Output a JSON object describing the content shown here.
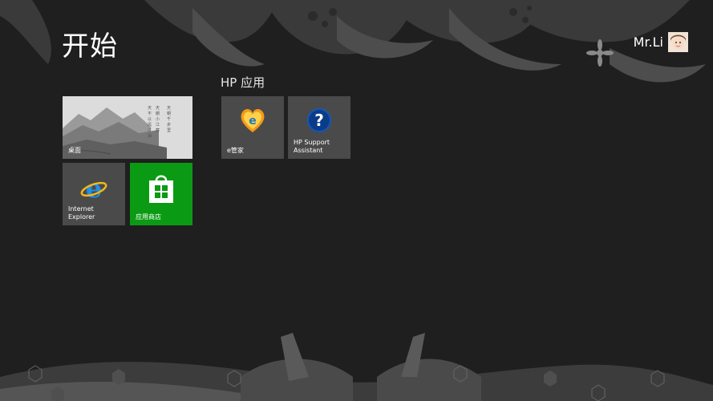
{
  "start": {
    "title": "开始"
  },
  "user": {
    "name": "Mr.Li"
  },
  "groups": [
    {
      "title": "HP 应用"
    }
  ],
  "tiles": {
    "desktop": {
      "label": "桌面",
      "poem_lines": [
        "天不以风江海",
        "天朝小江寒",
        "天朝千步里"
      ]
    },
    "ie": {
      "label": "Internet\nExplorer",
      "icon": "internet-explorer-icon"
    },
    "store": {
      "label": "应用商店",
      "icon": "store-icon"
    },
    "egj": {
      "label": "e管家",
      "icon": "e-manager-icon"
    },
    "hp_support": {
      "label": "HP Support\nAssistant",
      "icon": "help-icon"
    }
  },
  "colors": {
    "background": "#1f1f1f",
    "store_tile": "#0b9a14",
    "app_tile": "#4a4a4a"
  }
}
